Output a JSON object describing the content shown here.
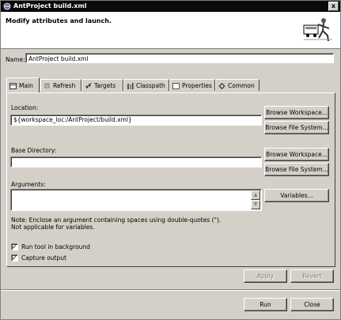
{
  "window": {
    "title": "AntProject build.xml",
    "close_label": "x"
  },
  "header": {
    "heading": "Modify attributes and launch."
  },
  "name": {
    "label": "Name:",
    "value": "AntProject build.xml"
  },
  "tabs": [
    {
      "label": "Main"
    },
    {
      "label": "Refresh"
    },
    {
      "label": "Targets"
    },
    {
      "label": "Classpath"
    },
    {
      "label": "Properties"
    },
    {
      "label": "Common"
    }
  ],
  "main": {
    "location_label": "Location:",
    "location_value": "${workspace_loc:/AntProject/build.xml}",
    "base_dir_label": "Base Directory:",
    "base_dir_value": "",
    "arguments_label": "Arguments:",
    "browse_workspace": "Browse Workspace...",
    "browse_file_system": "Browse File System...",
    "variables": "Variables...",
    "note_line1": "Note: Enclose an argument containing spaces using double-quotes (\").",
    "note_line2": "Not applicable for variables.",
    "run_bg_label": "Run tool in background",
    "capture_label": "Capture output",
    "run_bg_checked": true,
    "capture_checked": true
  },
  "actions": {
    "apply": "Apply",
    "revert": "Revert",
    "run": "Run",
    "close": "Close"
  }
}
